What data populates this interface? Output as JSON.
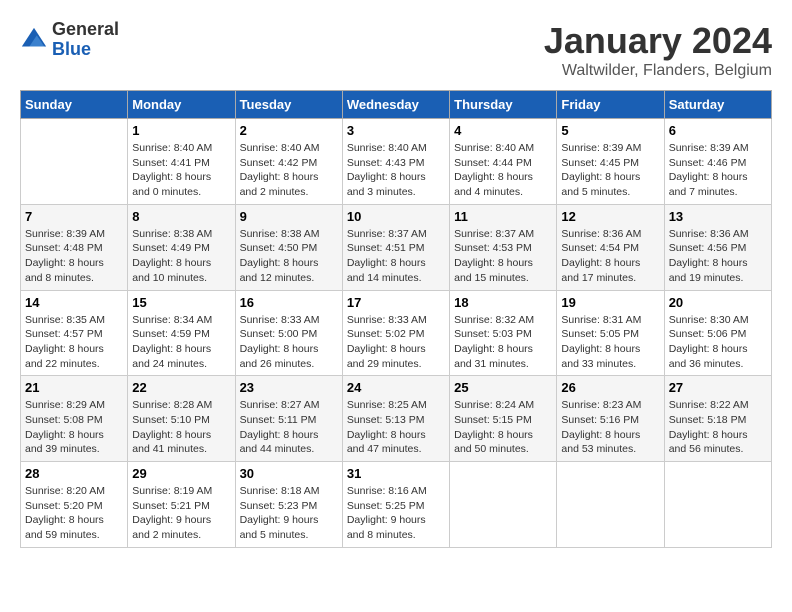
{
  "header": {
    "logo_line1": "General",
    "logo_line2": "Blue",
    "title": "January 2024",
    "subtitle": "Waltwilder, Flanders, Belgium"
  },
  "days_of_week": [
    "Sunday",
    "Monday",
    "Tuesday",
    "Wednesday",
    "Thursday",
    "Friday",
    "Saturday"
  ],
  "weeks": [
    [
      {
        "day": "",
        "sunrise": "",
        "sunset": "",
        "daylight": ""
      },
      {
        "day": "1",
        "sunrise": "Sunrise: 8:40 AM",
        "sunset": "Sunset: 4:41 PM",
        "daylight": "Daylight: 8 hours and 0 minutes."
      },
      {
        "day": "2",
        "sunrise": "Sunrise: 8:40 AM",
        "sunset": "Sunset: 4:42 PM",
        "daylight": "Daylight: 8 hours and 2 minutes."
      },
      {
        "day": "3",
        "sunrise": "Sunrise: 8:40 AM",
        "sunset": "Sunset: 4:43 PM",
        "daylight": "Daylight: 8 hours and 3 minutes."
      },
      {
        "day": "4",
        "sunrise": "Sunrise: 8:40 AM",
        "sunset": "Sunset: 4:44 PM",
        "daylight": "Daylight: 8 hours and 4 minutes."
      },
      {
        "day": "5",
        "sunrise": "Sunrise: 8:39 AM",
        "sunset": "Sunset: 4:45 PM",
        "daylight": "Daylight: 8 hours and 5 minutes."
      },
      {
        "day": "6",
        "sunrise": "Sunrise: 8:39 AM",
        "sunset": "Sunset: 4:46 PM",
        "daylight": "Daylight: 8 hours and 7 minutes."
      }
    ],
    [
      {
        "day": "7",
        "sunrise": "Sunrise: 8:39 AM",
        "sunset": "Sunset: 4:48 PM",
        "daylight": "Daylight: 8 hours and 8 minutes."
      },
      {
        "day": "8",
        "sunrise": "Sunrise: 8:38 AM",
        "sunset": "Sunset: 4:49 PM",
        "daylight": "Daylight: 8 hours and 10 minutes."
      },
      {
        "day": "9",
        "sunrise": "Sunrise: 8:38 AM",
        "sunset": "Sunset: 4:50 PM",
        "daylight": "Daylight: 8 hours and 12 minutes."
      },
      {
        "day": "10",
        "sunrise": "Sunrise: 8:37 AM",
        "sunset": "Sunset: 4:51 PM",
        "daylight": "Daylight: 8 hours and 14 minutes."
      },
      {
        "day": "11",
        "sunrise": "Sunrise: 8:37 AM",
        "sunset": "Sunset: 4:53 PM",
        "daylight": "Daylight: 8 hours and 15 minutes."
      },
      {
        "day": "12",
        "sunrise": "Sunrise: 8:36 AM",
        "sunset": "Sunset: 4:54 PM",
        "daylight": "Daylight: 8 hours and 17 minutes."
      },
      {
        "day": "13",
        "sunrise": "Sunrise: 8:36 AM",
        "sunset": "Sunset: 4:56 PM",
        "daylight": "Daylight: 8 hours and 19 minutes."
      }
    ],
    [
      {
        "day": "14",
        "sunrise": "Sunrise: 8:35 AM",
        "sunset": "Sunset: 4:57 PM",
        "daylight": "Daylight: 8 hours and 22 minutes."
      },
      {
        "day": "15",
        "sunrise": "Sunrise: 8:34 AM",
        "sunset": "Sunset: 4:59 PM",
        "daylight": "Daylight: 8 hours and 24 minutes."
      },
      {
        "day": "16",
        "sunrise": "Sunrise: 8:33 AM",
        "sunset": "Sunset: 5:00 PM",
        "daylight": "Daylight: 8 hours and 26 minutes."
      },
      {
        "day": "17",
        "sunrise": "Sunrise: 8:33 AM",
        "sunset": "Sunset: 5:02 PM",
        "daylight": "Daylight: 8 hours and 29 minutes."
      },
      {
        "day": "18",
        "sunrise": "Sunrise: 8:32 AM",
        "sunset": "Sunset: 5:03 PM",
        "daylight": "Daylight: 8 hours and 31 minutes."
      },
      {
        "day": "19",
        "sunrise": "Sunrise: 8:31 AM",
        "sunset": "Sunset: 5:05 PM",
        "daylight": "Daylight: 8 hours and 33 minutes."
      },
      {
        "day": "20",
        "sunrise": "Sunrise: 8:30 AM",
        "sunset": "Sunset: 5:06 PM",
        "daylight": "Daylight: 8 hours and 36 minutes."
      }
    ],
    [
      {
        "day": "21",
        "sunrise": "Sunrise: 8:29 AM",
        "sunset": "Sunset: 5:08 PM",
        "daylight": "Daylight: 8 hours and 39 minutes."
      },
      {
        "day": "22",
        "sunrise": "Sunrise: 8:28 AM",
        "sunset": "Sunset: 5:10 PM",
        "daylight": "Daylight: 8 hours and 41 minutes."
      },
      {
        "day": "23",
        "sunrise": "Sunrise: 8:27 AM",
        "sunset": "Sunset: 5:11 PM",
        "daylight": "Daylight: 8 hours and 44 minutes."
      },
      {
        "day": "24",
        "sunrise": "Sunrise: 8:25 AM",
        "sunset": "Sunset: 5:13 PM",
        "daylight": "Daylight: 8 hours and 47 minutes."
      },
      {
        "day": "25",
        "sunrise": "Sunrise: 8:24 AM",
        "sunset": "Sunset: 5:15 PM",
        "daylight": "Daylight: 8 hours and 50 minutes."
      },
      {
        "day": "26",
        "sunrise": "Sunrise: 8:23 AM",
        "sunset": "Sunset: 5:16 PM",
        "daylight": "Daylight: 8 hours and 53 minutes."
      },
      {
        "day": "27",
        "sunrise": "Sunrise: 8:22 AM",
        "sunset": "Sunset: 5:18 PM",
        "daylight": "Daylight: 8 hours and 56 minutes."
      }
    ],
    [
      {
        "day": "28",
        "sunrise": "Sunrise: 8:20 AM",
        "sunset": "Sunset: 5:20 PM",
        "daylight": "Daylight: 8 hours and 59 minutes."
      },
      {
        "day": "29",
        "sunrise": "Sunrise: 8:19 AM",
        "sunset": "Sunset: 5:21 PM",
        "daylight": "Daylight: 9 hours and 2 minutes."
      },
      {
        "day": "30",
        "sunrise": "Sunrise: 8:18 AM",
        "sunset": "Sunset: 5:23 PM",
        "daylight": "Daylight: 9 hours and 5 minutes."
      },
      {
        "day": "31",
        "sunrise": "Sunrise: 8:16 AM",
        "sunset": "Sunset: 5:25 PM",
        "daylight": "Daylight: 9 hours and 8 minutes."
      },
      {
        "day": "",
        "sunrise": "",
        "sunset": "",
        "daylight": ""
      },
      {
        "day": "",
        "sunrise": "",
        "sunset": "",
        "daylight": ""
      },
      {
        "day": "",
        "sunrise": "",
        "sunset": "",
        "daylight": ""
      }
    ]
  ]
}
